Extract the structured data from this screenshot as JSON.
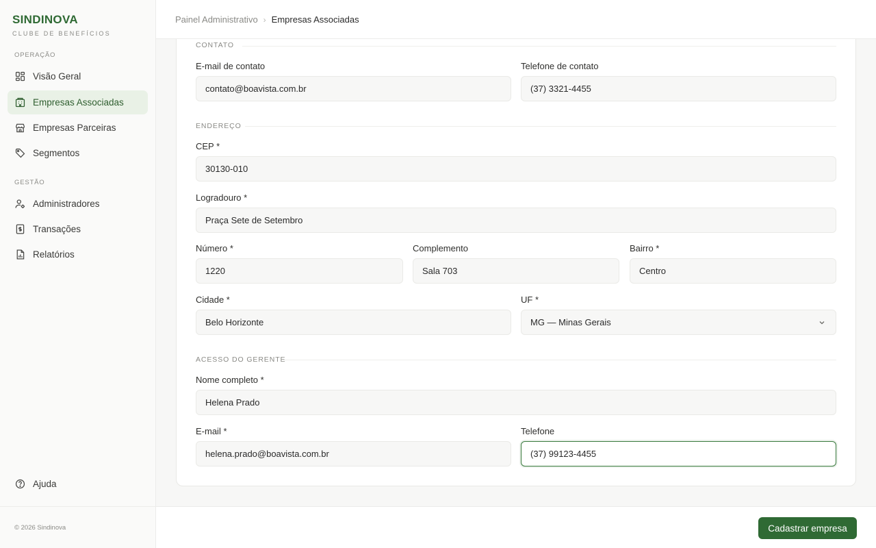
{
  "brand": {
    "name": "SINDINOVA",
    "subtitle": "CLUBE DE BENEFÍCIOS",
    "color": "#2f6a34"
  },
  "sidebar": {
    "sections": [
      {
        "title": "OPERAÇÃO"
      },
      {
        "title": "GESTÃO"
      }
    ],
    "items": [
      {
        "label": "Visão Geral",
        "icon": "grid-icon"
      },
      {
        "label": "Empresas Associadas",
        "icon": "building-icon",
        "active": true
      },
      {
        "label": "Empresas Parceiras",
        "icon": "store-icon"
      },
      {
        "label": "Segmentos",
        "icon": "tag-icon"
      },
      {
        "label": "Administradores",
        "icon": "user-gear-icon"
      },
      {
        "label": "Transações",
        "icon": "receipt-icon"
      },
      {
        "label": "Relatórios",
        "icon": "report-icon"
      },
      {
        "label": "Ajuda",
        "icon": "help-icon"
      }
    ],
    "copyright": "© 2026 Sindinova"
  },
  "breadcrumb": {
    "parent": "Painel Administrativo",
    "separator": "›",
    "current": "Empresas Associadas"
  },
  "form": {
    "contato": {
      "title": "CONTATO",
      "email_label": "E-mail de contato",
      "email_value": "contato@boavista.com.br",
      "phone_label": "Telefone de contato",
      "phone_value": "(37) 3321-4455"
    },
    "endereco": {
      "title": "ENDEREÇO",
      "cep_label": "CEP *",
      "cep_value": "30130-010",
      "logradouro_label": "Logradouro *",
      "logradouro_value": "Praça Sete de Setembro",
      "numero_label": "Número *",
      "numero_value": "1220",
      "complemento_label": "Complemento",
      "complemento_value": "Sala 703",
      "bairro_label": "Bairro *",
      "bairro_value": "Centro",
      "cidade_label": "Cidade *",
      "cidade_value": "Belo Horizonte",
      "uf_label": "UF *",
      "uf_value": "MG — Minas Gerais"
    },
    "gerente": {
      "title": "ACESSO DO GERENTE",
      "nome_label": "Nome completo *",
      "nome_value": "Helena Prado",
      "email_label": "E-mail *",
      "email_value": "helena.prado@boavista.com.br",
      "phone_label": "Telefone",
      "phone_value": "(37) 99123-4455"
    }
  },
  "actions": {
    "submit_label": "Cadastrar empresa"
  }
}
